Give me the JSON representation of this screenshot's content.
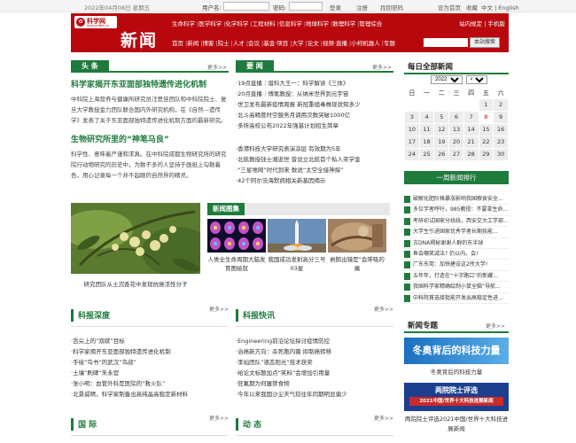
{
  "topbar": {
    "date": "2022年04月08日 星期五",
    "username_label": "用户名:",
    "password_label": "密码:",
    "login": "登录",
    "register": "注册",
    "forgot": "找回密码",
    "set_home": "设为首页",
    "favorite": "收藏",
    "lang": "中文 | English"
  },
  "masthead": {
    "logo_name": "科学网",
    "logo_icon": "✿",
    "logo_sub": "ScienceNet.cn",
    "title": "新闻",
    "nav1": [
      "生命科学",
      "医学科学",
      "化学科学",
      "工程材料",
      "信息科学",
      "地球科学",
      "数理科学",
      "管理综合"
    ],
    "nav2": [
      "首页",
      "新闻",
      "博客",
      "院士",
      "人才",
      "会议",
      "基金·项目",
      "大学",
      "论文",
      "视频·直播",
      "小柯机器人",
      "专题"
    ],
    "right_top": "站内规定 | 手机版",
    "search_button": "本站搜索"
  },
  "headlines": {
    "header": "头 条",
    "more": "更多>>",
    "lead_title": "科学家揭开东亚面部独特遗传进化机制",
    "lead_text": "中科院上海营养与健康所研究员汪思佳团队和中科院院士、复旦大学教授金力团队联合国内外研究机构，在《自然—遗传学》发表了关于东亚面部独特遗传进化机制方面的最新研究。",
    "second_title": "生物研究所里的“神笔马良”",
    "second_text": "科学性、意味着严谨和求真。在中科院成都生物研究所的研究院行动物研究的历史中，为数不多的人坚持于画纸上勾勒着色，用心记录每一个并不起眼的自然界的精灵。"
  },
  "important": {
    "header": "要 闻",
    "more": "更多>>",
    "items": [
      "·19点直播｜谱科大王一：科学解读《三体》",
      "·20点直播｜傅氮教授：从纳米世界到元宇宙",
      "·世卫发布最新疫情周报 新冠重组毒株现状知多少",
      "·北斗高精度时空服务月调用次数突破1000亿",
      "·多所高校公布2022年强基计划招生简章",
      "·香港科技大学研究表演涂层 有效期为5年",
      "·北航教授钱士湘逝世 曾设立北航首个私人奖学金",
      "·“三星堆网”时代到来 数说“太空全接神探”",
      "·42个阿尔茨海默病相关新基因揭示"
    ]
  },
  "main_photo": {
    "caption": "研究团队从土沉香花中发现抗癌活性分子"
  },
  "photo_news": {
    "header": "新闻图集",
    "items": [
      {
        "caption": "人类全生命周期大脑发育图绘就"
      },
      {
        "caption": "我国成功发射高分三号03星"
      },
      {
        "caption": "岩鹅出镜是“会呼吸的痛"
      }
    ]
  },
  "sections": {
    "depth": {
      "header": "科报深度",
      "more": "更多>>",
      "items": [
        "·舌尖上的“双碳”目标",
        "·科学家揭开东亚面部独特遗传进化机制",
        "·手绘“鸟书”的武汉“鸟叔”",
        "·土壤“刷碑”朱永官",
        "·张小明：血管外科是医院的“救火队”",
        "·北景戚晴，科学家制备出高纯晶高稳定新材料"
      ]
    },
    "express": {
      "header": "科报快讯",
      "more": "更多>>",
      "items": [
        "·Engineering前沿论坛探讨疫情防控",
        "·治癌新方向：杀死胞内菌 抑制癌转移",
        "·李灿团队“液态阳光”技术获奖",
        "·给论文标题加点“笑料”会增加引用量",
        "·狂氟期为何屡禁食物",
        "·今年以来我国沙尘天气较往年同期明显偏少"
      ]
    },
    "intl": {
      "header": "国 际",
      "more": "更多>>"
    },
    "trends": {
      "header": "动 态",
      "more": "更多>>"
    }
  },
  "sidebar": {
    "daily_header": "每日全部新闻",
    "year": "2022年",
    "month": "4月",
    "weekdays": [
      "日",
      "一",
      "二",
      "三",
      "四",
      "五",
      "六"
    ],
    "weeks": [
      [
        "",
        "",
        "",
        "",
        "",
        "1",
        "2"
      ],
      [
        "3",
        "4",
        "5",
        "6",
        "7",
        "8",
        "9"
      ],
      [
        "10",
        "11",
        "12",
        "13",
        "14",
        "15",
        "16"
      ],
      [
        "17",
        "18",
        "19",
        "20",
        "21",
        "22",
        "23"
      ],
      [
        "24",
        "25",
        "26",
        "27",
        "28",
        "29",
        "30"
      ]
    ],
    "today": "8",
    "weekly_button": "一周新闻排行",
    "ranking": [
      "破解化肥阶格暴涨影响我国粮食安全...",
      "多位学者呼吁，985教授：不要拿生命...",
      "考研初试国家分线线，西安交大工学部...",
      "大学生引进国家优秀学者长期技能...",
      "古DNA揭秘谢谢人群的东半球",
      "鱼会嘲笑减法? 仍以内。会!",
      "广东东莞：加快建设这2所大学!",
      "五年年，打造在“十字路口”的新藏...",
      "我国科学家精确绘制小鼠全脑“导航...",
      "中科院首选接批能开发出高稳定性进..."
    ],
    "topic_header": "新闻专题",
    "topic_more": "更多>>",
    "banner1_text": "冬奥背后的科技力量",
    "banner1_caption": "冬奥背后的科技力量",
    "banner2_line1": "两院院士评选",
    "banner2_line2": "2021中国/世界十大科技进展新闻",
    "banner2_caption": "两院院士评选2021中国/世界十大科技进展新闻"
  }
}
